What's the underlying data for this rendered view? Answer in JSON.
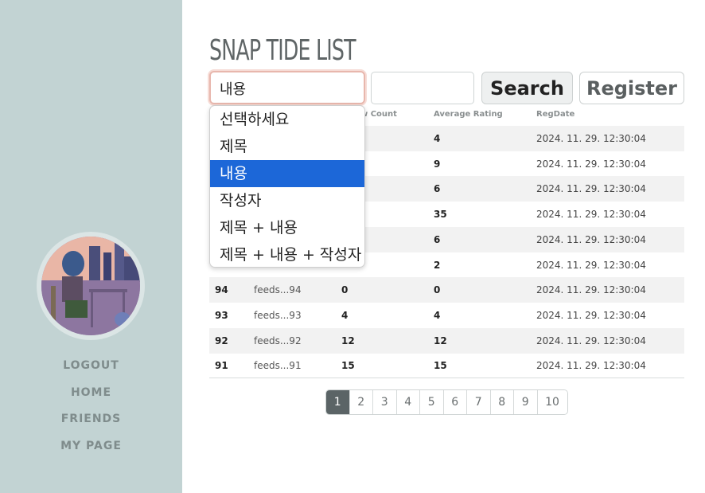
{
  "sidebar": {
    "nav": [
      "LOGOUT",
      "HOME",
      "FRIENDS",
      "MY PAGE"
    ]
  },
  "header": {
    "title": "SNAP TIDE  LIST"
  },
  "search": {
    "selected": "내용",
    "options": [
      "선택하세요",
      "제목",
      "내용",
      "작성자",
      "제목 + 내용",
      "제목 + 내용 + 작성자"
    ],
    "search_label": "Search",
    "register_label": "Register"
  },
  "table": {
    "headers": [
      "w Count",
      "Average Rating",
      "RegDate"
    ],
    "rows": [
      {
        "no": "",
        "title": "",
        "views": "",
        "rating": "4",
        "date": "2024. 11. 29. 12:30:04"
      },
      {
        "no": "",
        "title": "",
        "views": "",
        "rating": "9",
        "date": "2024. 11. 29. 12:30:04"
      },
      {
        "no": "",
        "title": "",
        "views": "",
        "rating": "6",
        "date": "2024. 11. 29. 12:30:04"
      },
      {
        "no": "",
        "title": "",
        "views": "",
        "rating": "35",
        "date": "2024. 11. 29. 12:30:04"
      },
      {
        "no": "",
        "title": "",
        "views": "",
        "rating": "6",
        "date": "2024. 11. 29. 12:30:04"
      },
      {
        "no": "",
        "title": "",
        "views": "",
        "rating": "2",
        "date": "2024. 11. 29. 12:30:04"
      },
      {
        "no": "94",
        "title": "feeds...94",
        "views": "0",
        "rating": "0",
        "date": "2024. 11. 29. 12:30:04"
      },
      {
        "no": "93",
        "title": "feeds...93",
        "views": "4",
        "rating": "4",
        "date": "2024. 11. 29. 12:30:04"
      },
      {
        "no": "92",
        "title": "feeds...92",
        "views": "12",
        "rating": "12",
        "date": "2024. 11. 29. 12:30:04"
      },
      {
        "no": "91",
        "title": "feeds...91",
        "views": "15",
        "rating": "15",
        "date": "2024. 11. 29. 12:30:04"
      }
    ]
  },
  "pagination": {
    "pages": [
      "1",
      "2",
      "3",
      "4",
      "5",
      "6",
      "7",
      "8",
      "9",
      "10"
    ],
    "active": "1"
  }
}
